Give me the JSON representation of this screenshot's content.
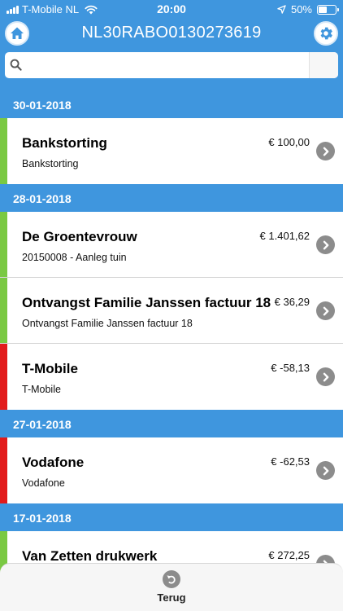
{
  "status_bar": {
    "carrier": "T-Mobile NL",
    "time": "20:00",
    "battery": "50%",
    "battery_level": 0.5
  },
  "header": {
    "title": "NL30RABO0130273619",
    "home_icon": "home-icon",
    "settings_icon": "gear-icon"
  },
  "search": {
    "placeholder": "",
    "value": "",
    "icon": "search-icon"
  },
  "colors": {
    "header_blue": "#3f96de",
    "income_green": "#7ac943",
    "expense_red": "#e21b1b"
  },
  "groups": [
    {
      "date": "30-01-2018",
      "transactions": [
        {
          "title": "Bankstorting",
          "description": "Bankstorting",
          "amount": "€ 100,00",
          "type": "income"
        }
      ]
    },
    {
      "date": "28-01-2018",
      "transactions": [
        {
          "title": "De Groentevrouw",
          "description": "20150008 - Aanleg tuin",
          "amount": "€ 1.401,62",
          "type": "income"
        },
        {
          "title": "Ontvangst Familie Janssen factuur 18",
          "description": "Ontvangst Familie Janssen factuur 18",
          "amount": "€ 36,29",
          "type": "income"
        },
        {
          "title": "T-Mobile",
          "description": "T-Mobile",
          "amount": "€ -58,13",
          "type": "expense"
        }
      ]
    },
    {
      "date": "27-01-2018",
      "transactions": [
        {
          "title": "Vodafone",
          "description": "Vodafone",
          "amount": "€ -62,53",
          "type": "expense"
        }
      ]
    },
    {
      "date": "17-01-2018",
      "transactions": [
        {
          "title": "Van Zetten drukwerk",
          "description": "",
          "amount": "€ 272,25",
          "type": "income"
        }
      ]
    }
  ],
  "footer": {
    "back_label": "Terug",
    "back_icon": "undo-icon"
  }
}
